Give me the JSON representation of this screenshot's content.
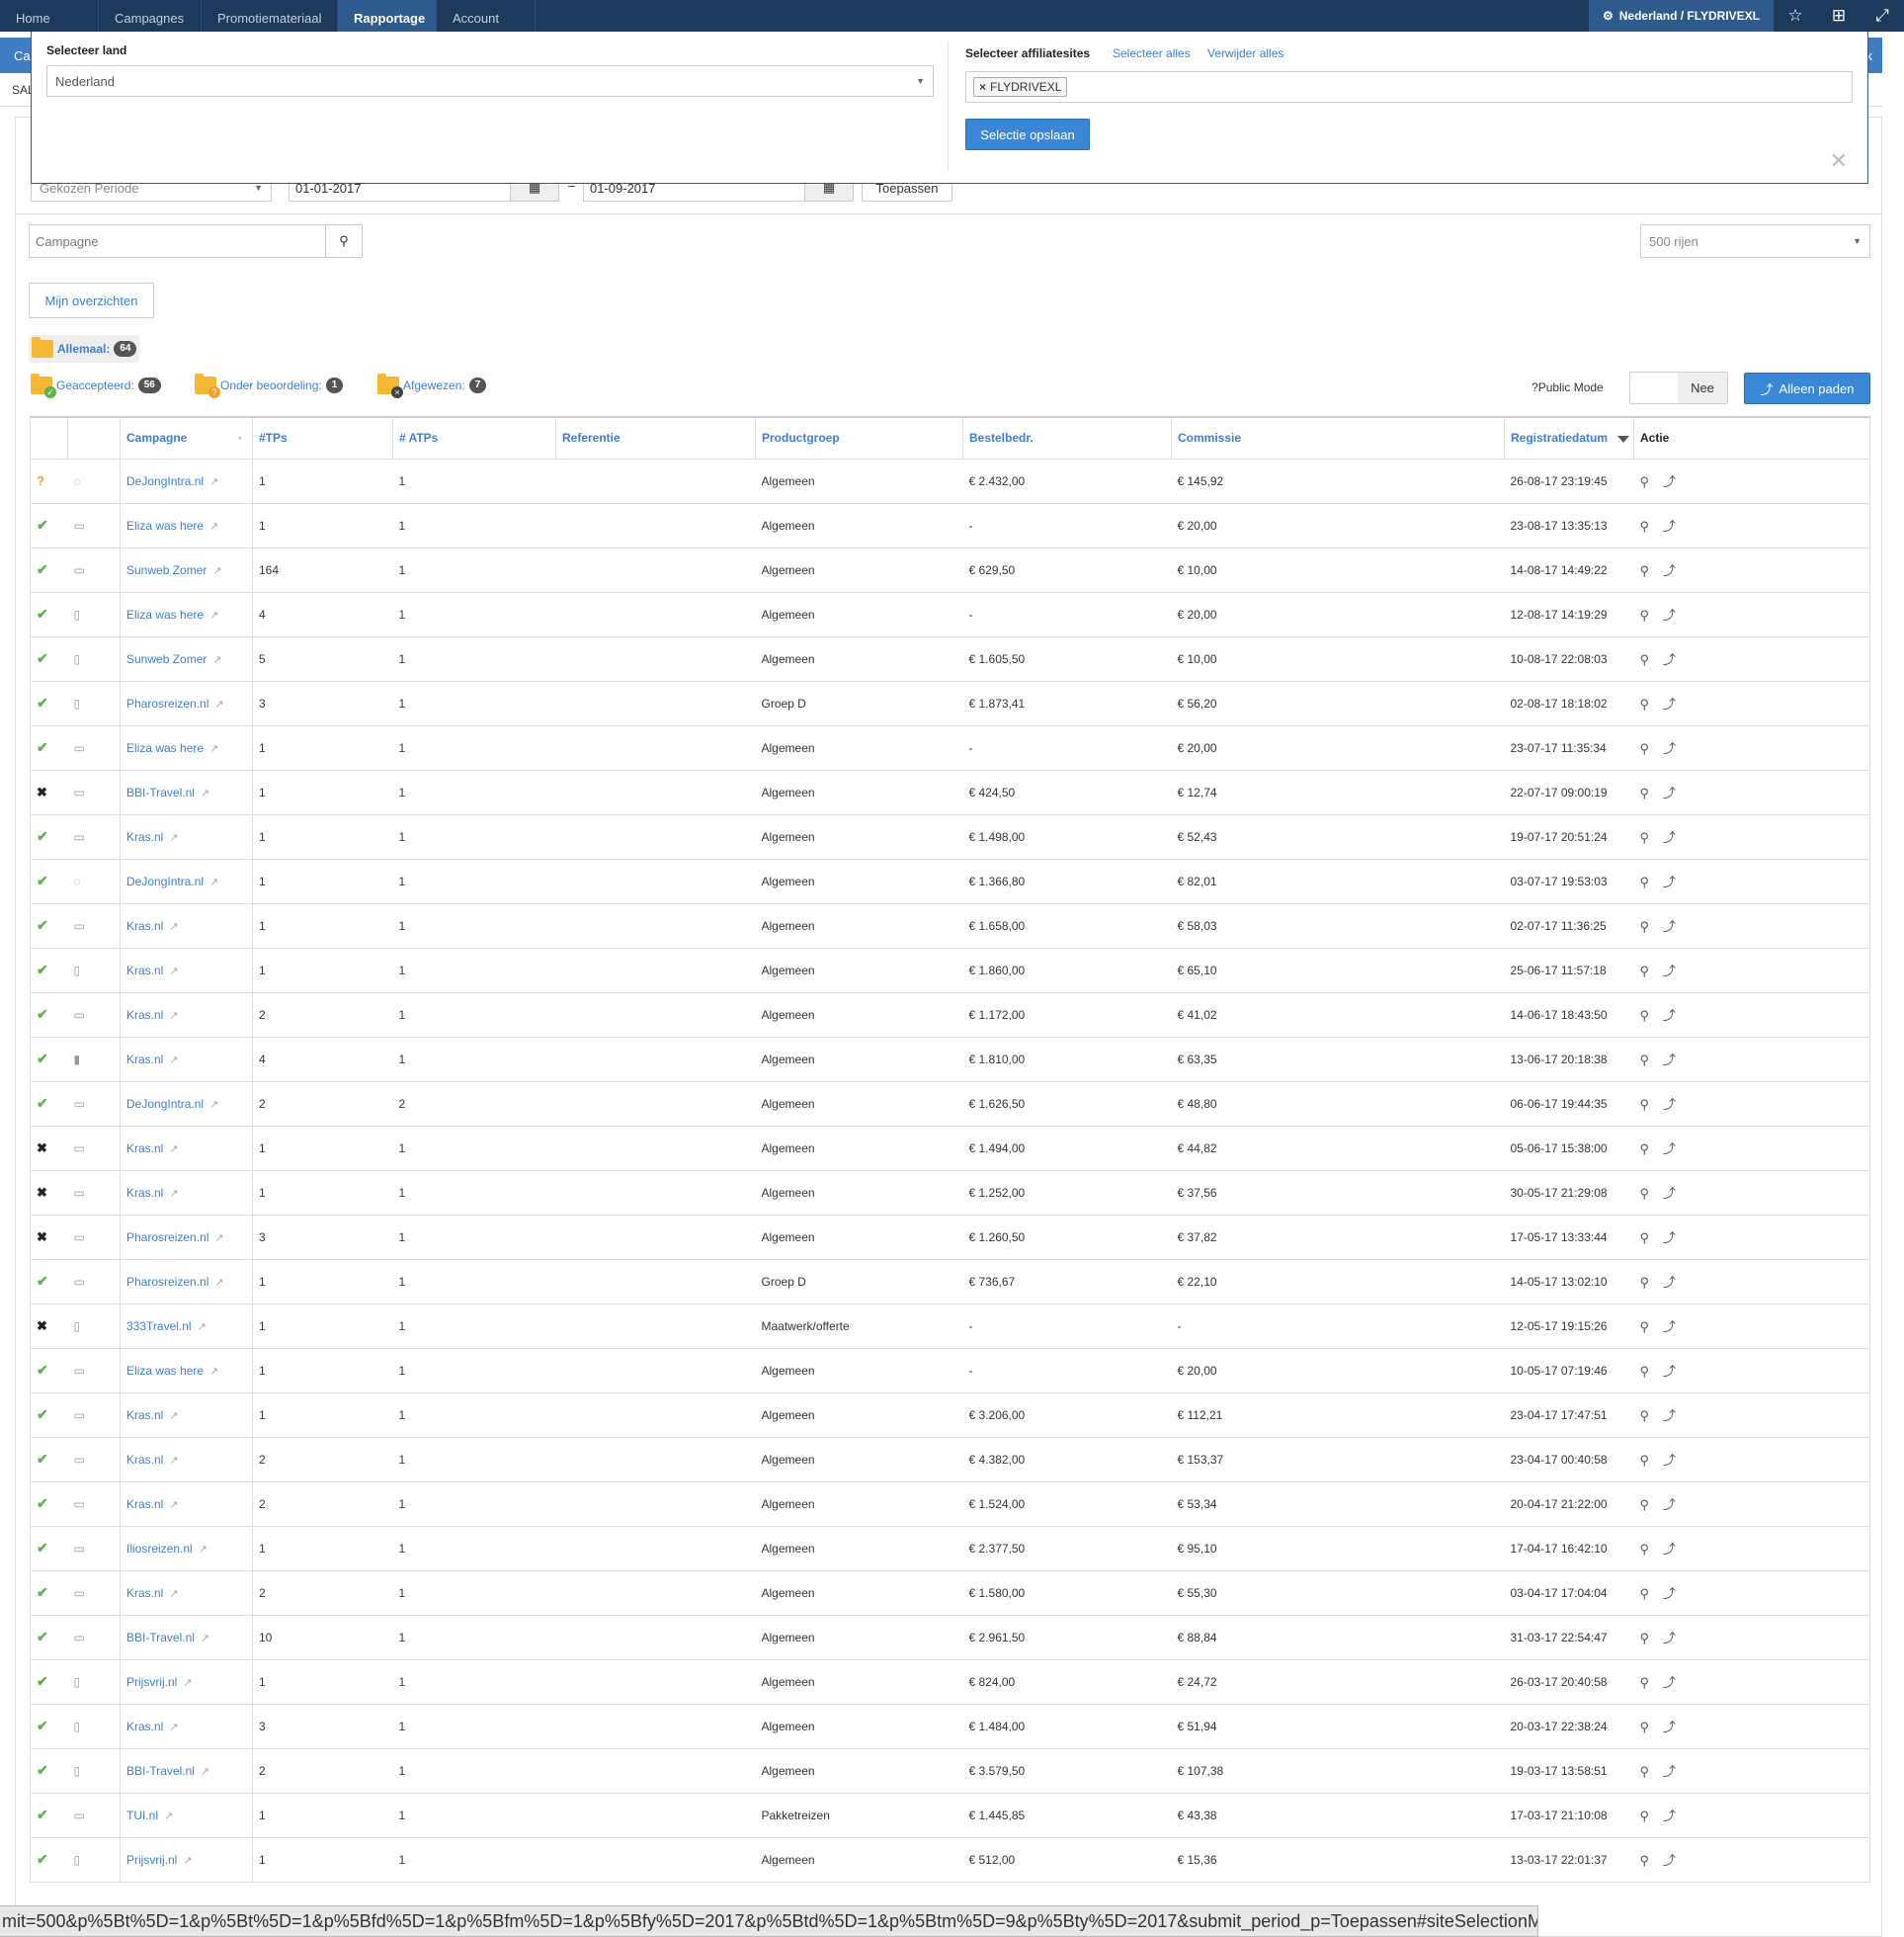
{
  "nav": {
    "tabs": [
      "Home",
      "Campagnes",
      "Promotiemateriaal",
      "Rapportage",
      "Account"
    ],
    "active": "Rapportage",
    "country": "Nederland / FLYDRIVEXL"
  },
  "subbar": {
    "left": "Ca",
    "right": "ek",
    "sub_left": "SAL"
  },
  "modal": {
    "country_label": "Selecteer land",
    "country_value": "Nederland",
    "sites_label": "Selecteer affiliatesites",
    "select_all": "Selecteer alles",
    "remove_all": "Verwijder alles",
    "tag": "FLYDRIVEXL",
    "save": "Selectie opslaan"
  },
  "period": {
    "select": "Gekozen Periode",
    "from": "01-01-2017",
    "to": "01-09-2017",
    "apply": "Toepassen",
    "sep": "–"
  },
  "search": {
    "placeholder": "Campagne",
    "rows": "500 rijen"
  },
  "overview_btn": "Mijn overzichten",
  "folders": {
    "all": "Allemaal:",
    "all_count": "64",
    "accepted": "Geaccepteerd:",
    "accepted_count": "56",
    "review": "Onder beoordeling:",
    "review_count": "1",
    "rejected": "Afgewezen:",
    "rejected_count": "7"
  },
  "public_mode": {
    "label": "Public Mode",
    "value": "Nee"
  },
  "only_paths": "Alleen paden",
  "columns": [
    "Campagne",
    "#TPs",
    "# ATPs",
    "Referentie",
    "Productgroep",
    "Bestelbedr.",
    "Commissie",
    "Registratiedatum",
    "Actie"
  ],
  "rows": [
    {
      "s": "q",
      "d": "sync",
      "c": "DeJongIntra.nl",
      "tp": "1",
      "atp": "1",
      "pg": "Algemeen",
      "b": "€ 2.432,00",
      "k": "€ 145,92",
      "dt": "26-08-17 23:19:45"
    },
    {
      "s": "ok",
      "d": "desktop",
      "c": "Eliza was here",
      "tp": "1",
      "atp": "1",
      "pg": "Algemeen",
      "b": "-",
      "k": "€ 20,00",
      "dt": "23-08-17 13:35:13"
    },
    {
      "s": "ok",
      "d": "desktop",
      "c": "Sunweb Zomer",
      "tp": "164",
      "atp": "1",
      "pg": "Algemeen",
      "b": "€ 629,50",
      "k": "€ 10,00",
      "dt": "14-08-17 14:49:22"
    },
    {
      "s": "ok",
      "d": "tablet",
      "c": "Eliza was here",
      "tp": "4",
      "atp": "1",
      "pg": "Algemeen",
      "b": "-",
      "k": "€ 20,00",
      "dt": "12-08-17 14:19:29"
    },
    {
      "s": "ok",
      "d": "tablet",
      "c": "Sunweb Zomer",
      "tp": "5",
      "atp": "1",
      "pg": "Algemeen",
      "b": "€ 1.605,50",
      "k": "€ 10,00",
      "dt": "10-08-17 22:08:03"
    },
    {
      "s": "ok",
      "d": "tablet",
      "c": "Pharosreizen.nl",
      "tp": "3",
      "atp": "1",
      "pg": "Groep D",
      "b": "€ 1.873,41",
      "k": "€ 56,20",
      "dt": "02-08-17 18:18:02"
    },
    {
      "s": "ok",
      "d": "desktop",
      "c": "Eliza was here",
      "tp": "1",
      "atp": "1",
      "pg": "Algemeen",
      "b": "-",
      "k": "€ 20,00",
      "dt": "23-07-17 11:35:34"
    },
    {
      "s": "no",
      "d": "desktop",
      "c": "BBI-Travel.nl",
      "tp": "1",
      "atp": "1",
      "pg": "Algemeen",
      "b": "€ 424,50",
      "k": "€ 12,74",
      "dt": "22-07-17 09:00:19"
    },
    {
      "s": "ok",
      "d": "desktop",
      "c": "Kras.nl",
      "tp": "1",
      "atp": "1",
      "pg": "Algemeen",
      "b": "€ 1.498,00",
      "k": "€ 52,43",
      "dt": "19-07-17 20:51:24"
    },
    {
      "s": "ok",
      "d": "sync",
      "c": "DeJongIntra.nl",
      "tp": "1",
      "atp": "1",
      "pg": "Algemeen",
      "b": "€ 1.366,80",
      "k": "€ 82,01",
      "dt": "03-07-17 19:53:03"
    },
    {
      "s": "ok",
      "d": "desktop",
      "c": "Kras.nl",
      "tp": "1",
      "atp": "1",
      "pg": "Algemeen",
      "b": "€ 1.658,00",
      "k": "€ 58,03",
      "dt": "02-07-17 11:36:25"
    },
    {
      "s": "ok",
      "d": "tablet",
      "c": "Kras.nl",
      "tp": "1",
      "atp": "1",
      "pg": "Algemeen",
      "b": "€ 1.860,00",
      "k": "€ 65,10",
      "dt": "25-06-17 11:57:18"
    },
    {
      "s": "ok",
      "d": "desktop",
      "c": "Kras.nl",
      "tp": "2",
      "atp": "1",
      "pg": "Algemeen",
      "b": "€ 1.172,00",
      "k": "€ 41,02",
      "dt": "14-06-17 18:43:50"
    },
    {
      "s": "ok",
      "d": "mobile",
      "c": "Kras.nl",
      "tp": "4",
      "atp": "1",
      "pg": "Algemeen",
      "b": "€ 1.810,00",
      "k": "€ 63,35",
      "dt": "13-06-17 20:18:38"
    },
    {
      "s": "ok",
      "d": "desktop",
      "c": "DeJongIntra.nl",
      "tp": "2",
      "atp": "2",
      "pg": "Algemeen",
      "b": "€ 1.626,50",
      "k": "€ 48,80",
      "dt": "06-06-17 19:44:35"
    },
    {
      "s": "no",
      "d": "desktop",
      "c": "Kras.nl",
      "tp": "1",
      "atp": "1",
      "pg": "Algemeen",
      "b": "€ 1.494,00",
      "k": "€ 44,82",
      "dt": "05-06-17 15:38:00"
    },
    {
      "s": "no",
      "d": "desktop",
      "c": "Kras.nl",
      "tp": "1",
      "atp": "1",
      "pg": "Algemeen",
      "b": "€ 1.252,00",
      "k": "€ 37,56",
      "dt": "30-05-17 21:29:08"
    },
    {
      "s": "no",
      "d": "desktop",
      "c": "Pharosreizen.nl",
      "tp": "3",
      "atp": "1",
      "pg": "Algemeen",
      "b": "€ 1.260,50",
      "k": "€ 37,82",
      "dt": "17-05-17 13:33:44"
    },
    {
      "s": "ok",
      "d": "desktop",
      "c": "Pharosreizen.nl",
      "tp": "1",
      "atp": "1",
      "pg": "Groep D",
      "b": "€ 736,67",
      "k": "€ 22,10",
      "dt": "14-05-17 13:02:10"
    },
    {
      "s": "no",
      "d": "tablet",
      "c": "333Travel.nl",
      "tp": "1",
      "atp": "1",
      "pg": "Maatwerk/offerte",
      "b": "-",
      "k": "-",
      "dt": "12-05-17 19:15:26"
    },
    {
      "s": "ok",
      "d": "desktop",
      "c": "Eliza was here",
      "tp": "1",
      "atp": "1",
      "pg": "Algemeen",
      "b": "-",
      "k": "€ 20,00",
      "dt": "10-05-17 07:19:46"
    },
    {
      "s": "ok",
      "d": "desktop",
      "c": "Kras.nl",
      "tp": "1",
      "atp": "1",
      "pg": "Algemeen",
      "b": "€ 3.206,00",
      "k": "€ 112,21",
      "dt": "23-04-17 17:47:51"
    },
    {
      "s": "ok",
      "d": "desktop",
      "c": "Kras.nl",
      "tp": "2",
      "atp": "1",
      "pg": "Algemeen",
      "b": "€ 4.382,00",
      "k": "€ 153,37",
      "dt": "23-04-17 00:40:58"
    },
    {
      "s": "ok",
      "d": "desktop",
      "c": "Kras.nl",
      "tp": "2",
      "atp": "1",
      "pg": "Algemeen",
      "b": "€ 1.524,00",
      "k": "€ 53,34",
      "dt": "20-04-17 21:22:00"
    },
    {
      "s": "ok",
      "d": "desktop",
      "c": "Iliosreizen.nl",
      "tp": "1",
      "atp": "1",
      "pg": "Algemeen",
      "b": "€ 2.377,50",
      "k": "€ 95,10",
      "dt": "17-04-17 16:42:10"
    },
    {
      "s": "ok",
      "d": "desktop",
      "c": "Kras.nl",
      "tp": "2",
      "atp": "1",
      "pg": "Algemeen",
      "b": "€ 1.580,00",
      "k": "€ 55,30",
      "dt": "03-04-17 17:04:04"
    },
    {
      "s": "ok",
      "d": "desktop",
      "c": "BBI-Travel.nl",
      "tp": "10",
      "atp": "1",
      "pg": "Algemeen",
      "b": "€ 2.961,50",
      "k": "€ 88,84",
      "dt": "31-03-17 22:54:47"
    },
    {
      "s": "ok",
      "d": "tablet",
      "c": "Prijsvrij.nl",
      "tp": "1",
      "atp": "1",
      "pg": "Algemeen",
      "b": "€ 824,00",
      "k": "€ 24,72",
      "dt": "26-03-17 20:40:58"
    },
    {
      "s": "ok",
      "d": "tablet",
      "c": "Kras.nl",
      "tp": "3",
      "atp": "1",
      "pg": "Algemeen",
      "b": "€ 1.484,00",
      "k": "€ 51,94",
      "dt": "20-03-17 22:38:24"
    },
    {
      "s": "ok",
      "d": "tablet",
      "c": "BBI-Travel.nl",
      "tp": "2",
      "atp": "1",
      "pg": "Algemeen",
      "b": "€ 3.579,50",
      "k": "€ 107,38",
      "dt": "19-03-17 13:58:51"
    },
    {
      "s": "ok",
      "d": "desktop",
      "c": "TUI.nl",
      "tp": "1",
      "atp": "1",
      "pg": "Pakketreizen",
      "b": "€ 1.445,85",
      "k": "€ 43,38",
      "dt": "17-03-17 21:10:08"
    },
    {
      "s": "ok",
      "d": "tablet",
      "c": "Prijsvrij.nl",
      "tp": "1",
      "atp": "1",
      "pg": "Algemeen",
      "b": "€ 512,00",
      "k": "€ 15,36",
      "dt": "13-03-17 22:01:37"
    }
  ],
  "statusbar": "mit=500&p%5Bt%5D=1&p%5Bt%5D=1&p%5Bfd%5D=1&p%5Bfm%5D=1&p%5Bfy%5D=2017&p%5Btd%5D=1&p%5Btm%5D=9&p%5Bty%5D=2017&submit_period_p=Toepassen#siteSelectionModal"
}
